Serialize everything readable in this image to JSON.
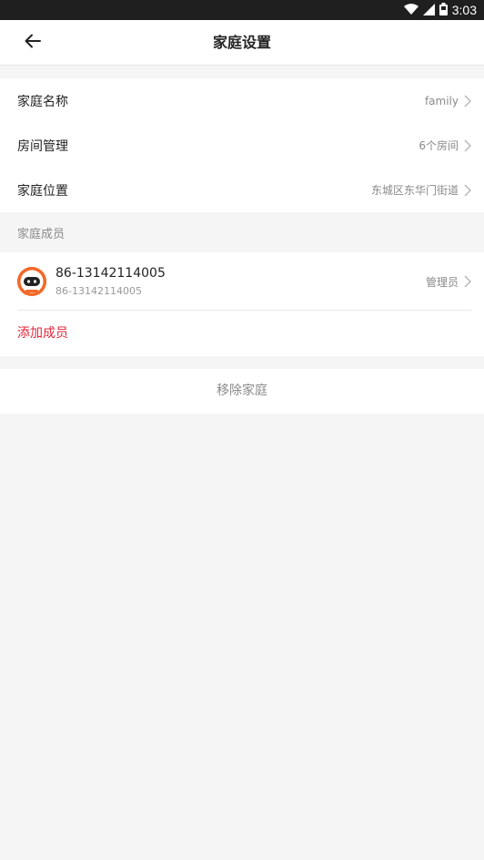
{
  "status_bar": {
    "time": "3:03",
    "icons": [
      "wifi-icon",
      "signal-icon",
      "battery-icon"
    ]
  },
  "header": {
    "back_icon": "back-arrow-icon",
    "title": "家庭设置"
  },
  "settings": {
    "items": [
      {
        "label": "家庭名称",
        "value": "family"
      },
      {
        "label": "房间管理",
        "value": "6个房间"
      },
      {
        "label": "家庭位置",
        "value": "东城区东华门街道"
      }
    ]
  },
  "members": {
    "header": "家庭成员",
    "list": [
      {
        "name": "86-13142114005",
        "subtitle": "86-13142114005",
        "role": "管理员",
        "avatar_icon": "robot-avatar-icon"
      }
    ],
    "add_label": "添加成员"
  },
  "actions": {
    "remove_label": "移除家庭"
  },
  "colors": {
    "accent_red": "#e0263a",
    "avatar_orange": "#f06a2a",
    "background": "#f5f5f5"
  }
}
